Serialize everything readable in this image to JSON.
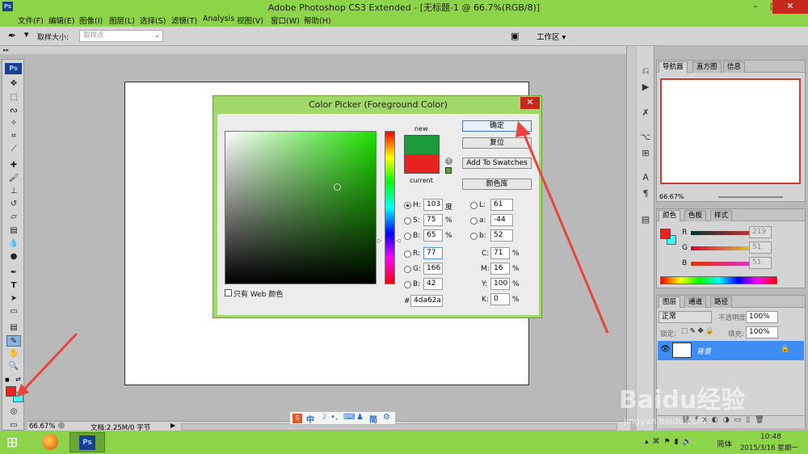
{
  "app": {
    "ps_logo": "Ps",
    "title": "Adobe Photoshop CS3 Extended - [无标题-1 @ 66.7%(RGB/8)]",
    "win_min": "–",
    "win_max": "▢",
    "win_close": "✕"
  },
  "menu": [
    "文件(F)",
    "编辑(E)",
    "图像(I)",
    "图层(L)",
    "选择(S)",
    "滤镜(T)",
    "Analysis",
    "视图(V)",
    "窗口(W)",
    "帮助(H)"
  ],
  "options": {
    "sample_label": "取样大小:",
    "sample_value": "取样点",
    "workspace": "工作区"
  },
  "toolbox": {
    "logo": "Ps"
  },
  "dialog": {
    "title": "Color Picker (Foreground Color)",
    "close": "✕",
    "new_label": "new",
    "current_label": "current",
    "new_color": "#1d9a3a",
    "current_color": "#e8231f",
    "ok": "确定",
    "reset": "复位",
    "add_swatches": "Add To Swatches",
    "color_libraries": "颜色库",
    "web_only": "只有 Web 颜色",
    "fields": {
      "H": {
        "label": "H:",
        "value": "103",
        "unit": "度"
      },
      "S": {
        "label": "S:",
        "value": "75",
        "unit": "%"
      },
      "Bv": {
        "label": "B:",
        "value": "65",
        "unit": "%"
      },
      "R": {
        "label": "R:",
        "value": "77"
      },
      "G": {
        "label": "G:",
        "value": "166"
      },
      "Bl": {
        "label": "B:",
        "value": "42"
      },
      "L": {
        "label": "L:",
        "value": "61"
      },
      "a": {
        "label": "a:",
        "value": "-44"
      },
      "b": {
        "label": "b:",
        "value": "52"
      },
      "C": {
        "label": "C:",
        "value": "71",
        "unit": "%"
      },
      "M": {
        "label": "M:",
        "value": "16",
        "unit": "%"
      },
      "Y": {
        "label": "Y:",
        "value": "100",
        "unit": "%"
      },
      "K": {
        "label": "K:",
        "value": "0",
        "unit": "%"
      },
      "hex_label": "#",
      "hex": "4da62a"
    }
  },
  "status": {
    "zoom": "66.67%",
    "doc": "文档:2.25M/0 字节"
  },
  "navigator": {
    "tabs": [
      "导航器",
      "直方图",
      "信息"
    ],
    "zoom": "66.67%"
  },
  "color_panel": {
    "tabs": [
      "颜色",
      "色板",
      "样式"
    ],
    "r_label": "R",
    "r_value": "219",
    "g_label": "G",
    "g_value": "51",
    "b_label": "B",
    "b_value": "51"
  },
  "layers_panel": {
    "tabs": [
      "图层",
      "通道",
      "路径"
    ],
    "blend": "正常",
    "opacity_label": "不透明度:",
    "opacity": "100%",
    "lock_label": "锁定:",
    "fill_label": "填充:",
    "fill": "100%",
    "layer_name": "背景"
  },
  "ime": {
    "items": [
      "中",
      "简"
    ]
  },
  "taskbar": {
    "ps": "Ps",
    "lang": "简体",
    "time": "10:48",
    "date": "2015/3/16 星期一"
  },
  "watermark": {
    "line1": "Baidu经验",
    "line2": "jingyan.baidu.com"
  }
}
